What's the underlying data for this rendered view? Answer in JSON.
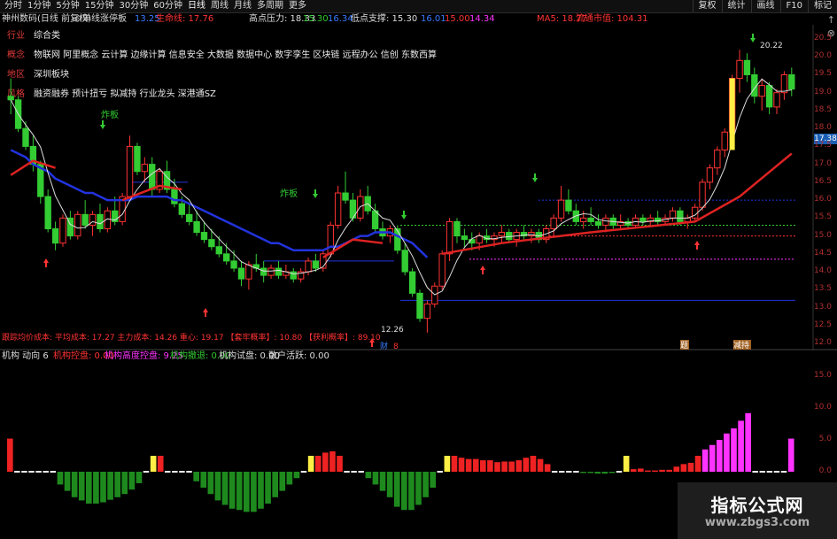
{
  "topbar": {
    "tabs": [
      "分时",
      "1分钟",
      "5分钟",
      "15分钟",
      "30分钟",
      "60分钟",
      "日线",
      "周线",
      "月线",
      "多周期",
      "更多"
    ],
    "active": "日线",
    "right": [
      "复权",
      "统计",
      "画线",
      "F10",
      "标记"
    ]
  },
  "info": {
    "stock": "神州数码(日线 前复权)",
    "indicator": "单线涨停板",
    "v1": "13.25",
    "lifeline_label": "生命线: 17.76",
    "high_label": "高点压力: 18.33",
    "high_v1": "15.30",
    "high_v2": "16.34",
    "low_label": "低点支撑: 15.30",
    "low_v0": "16.01",
    "low_v1": "15.00",
    "low_v2": "14.34",
    "ma5": "MA5: 18.77",
    "mktcap": "流通市值: 104.31"
  },
  "categories": [
    {
      "key": "行业",
      "value": "综合类"
    },
    {
      "key": "概念",
      "value": "物联网 阿里概念 云计算 边缘计算 信息安全 大数据 数据中心 数字孪生 区块链 远程办公 信创 东数西算"
    },
    {
      "key": "地区",
      "value": "深圳板块"
    },
    {
      "key": "风格",
      "value": "融资融券 预计扭亏 拟减持 行业龙头 深港通SZ"
    }
  ],
  "yaxis": [
    "20.5",
    "20.0",
    "19.5",
    "19.0",
    "18.5",
    "18.0",
    "17.5",
    "17.0",
    "16.5",
    "16.0",
    "15.5",
    "15.0",
    "14.5",
    "14.0",
    "13.5",
    "13.0",
    "12.5",
    "12.0"
  ],
  "yaxis_bottom": [
    "15.0",
    "10.0",
    "5.0",
    "0.0"
  ],
  "price_tag": "17.38",
  "annot": {
    "high_price": "20.22",
    "low_price": "12.26",
    "zhaban1": "炸板",
    "zhaban2": "炸板",
    "cost_line": "跟踪均价成本: 平均成本: 17.27  主力成本: 14.26  重心: 19.17  【套牢概率】: 10.80  【获利概率】: 89.10",
    "tag_cai": "财",
    "tag_8": "8",
    "tag_ju": "题",
    "tag_jian": "减持"
  },
  "bottom_info": {
    "title": "机构 动向 6",
    "k1": "机构控盘: 0.00",
    "k2": "机构高度控盘: 9.25",
    "k3": "机构撤退: 0.00",
    "k4": "机构试盘: 0.00",
    "k5": "散户活跃: 0.00"
  },
  "watermark": {
    "title": "指标公式网",
    "url": "www.zbgs3.com"
  },
  "colors": {
    "up": "#ff3333",
    "down": "#33cc33",
    "ma_blue": "#2233dd",
    "life_red": "#dd2222",
    "magenta": "#ff33ff",
    "yellow": "#ffee44"
  },
  "chart_data": {
    "type": "candlestick",
    "ylim": [
      12.0,
      20.5
    ],
    "candles": [
      [
        18.9,
        19.4,
        18.4,
        18.8
      ],
      [
        18.8,
        18.9,
        17.9,
        18.0
      ],
      [
        18.0,
        18.2,
        17.4,
        17.5
      ],
      [
        17.5,
        17.8,
        16.8,
        17.0
      ],
      [
        17.0,
        17.1,
        15.9,
        16.1
      ],
      [
        16.1,
        16.3,
        15.1,
        15.2
      ],
      [
        15.2,
        15.4,
        14.6,
        14.8
      ],
      [
        14.8,
        15.6,
        14.7,
        15.5
      ],
      [
        15.5,
        15.7,
        14.9,
        15.0
      ],
      [
        15.0,
        15.7,
        14.9,
        15.6
      ],
      [
        15.6,
        16.0,
        15.2,
        15.3
      ],
      [
        15.3,
        15.7,
        15.0,
        15.6
      ],
      [
        15.6,
        15.9,
        15.1,
        15.2
      ],
      [
        15.2,
        15.8,
        15.1,
        15.7
      ],
      [
        15.7,
        16.1,
        15.3,
        15.4
      ],
      [
        15.4,
        16.2,
        15.3,
        16.1
      ],
      [
        16.1,
        17.8,
        16.0,
        17.5
      ],
      [
        17.5,
        17.6,
        16.7,
        16.8
      ],
      [
        16.8,
        17.2,
        16.5,
        17.0
      ],
      [
        17.0,
        17.2,
        16.1,
        16.3
      ],
      [
        16.3,
        16.9,
        16.2,
        16.8
      ],
      [
        16.8,
        17.1,
        16.2,
        16.3
      ],
      [
        16.3,
        16.6,
        15.8,
        15.9
      ],
      [
        15.9,
        16.1,
        15.5,
        15.6
      ],
      [
        15.6,
        15.9,
        15.3,
        15.4
      ],
      [
        15.4,
        15.7,
        15.0,
        15.1
      ],
      [
        15.1,
        15.4,
        14.8,
        14.9
      ],
      [
        14.9,
        15.2,
        14.6,
        14.7
      ],
      [
        14.7,
        15.0,
        14.4,
        14.5
      ],
      [
        14.5,
        14.8,
        14.2,
        14.3
      ],
      [
        14.3,
        14.6,
        14.0,
        14.1
      ],
      [
        14.1,
        14.3,
        13.6,
        13.8
      ],
      [
        13.8,
        14.3,
        13.5,
        14.2
      ],
      [
        14.2,
        14.5,
        14.0,
        14.1
      ],
      [
        14.1,
        14.3,
        13.7,
        13.9
      ],
      [
        13.9,
        14.2,
        13.8,
        14.1
      ],
      [
        14.1,
        14.3,
        13.8,
        13.9
      ],
      [
        13.9,
        14.2,
        13.8,
        14.0
      ],
      [
        14.0,
        14.1,
        13.7,
        13.8
      ],
      [
        13.8,
        14.1,
        13.7,
        14.0
      ],
      [
        14.0,
        14.4,
        13.9,
        14.3
      ],
      [
        14.3,
        14.5,
        14.0,
        14.1
      ],
      [
        14.1,
        14.6,
        14.0,
        14.5
      ],
      [
        14.5,
        15.4,
        14.4,
        15.3
      ],
      [
        15.3,
        16.4,
        15.2,
        16.2
      ],
      [
        16.2,
        16.8,
        15.9,
        16.0
      ],
      [
        16.0,
        16.2,
        15.4,
        15.5
      ],
      [
        15.5,
        16.3,
        15.4,
        16.1
      ],
      [
        16.1,
        16.4,
        15.6,
        15.7
      ],
      [
        15.7,
        15.9,
        15.1,
        15.2
      ],
      [
        15.2,
        15.4,
        14.9,
        15.0
      ],
      [
        15.0,
        15.3,
        14.8,
        15.2
      ],
      [
        15.2,
        15.3,
        14.5,
        14.6
      ],
      [
        14.6,
        14.8,
        13.9,
        14.0
      ],
      [
        14.0,
        14.1,
        13.3,
        13.4
      ],
      [
        13.4,
        13.5,
        12.6,
        12.7
      ],
      [
        12.7,
        13.2,
        12.3,
        13.1
      ],
      [
        13.1,
        13.7,
        13.0,
        13.6
      ],
      [
        13.6,
        14.6,
        13.5,
        14.5
      ],
      [
        14.5,
        15.5,
        14.3,
        15.4
      ],
      [
        15.4,
        15.5,
        14.8,
        15.0
      ],
      [
        15.0,
        15.2,
        14.7,
        14.9
      ],
      [
        14.9,
        15.1,
        14.6,
        14.8
      ],
      [
        14.8,
        15.1,
        14.6,
        15.0
      ],
      [
        15.0,
        15.2,
        14.8,
        14.9
      ],
      [
        14.9,
        15.1,
        14.7,
        15.0
      ],
      [
        15.0,
        15.3,
        14.8,
        15.1
      ],
      [
        15.1,
        15.2,
        14.8,
        14.9
      ],
      [
        14.9,
        15.2,
        14.7,
        15.1
      ],
      [
        15.1,
        15.3,
        14.9,
        15.0
      ],
      [
        15.0,
        15.2,
        14.8,
        15.1
      ],
      [
        15.1,
        15.2,
        14.8,
        14.9
      ],
      [
        14.9,
        15.3,
        14.8,
        15.2
      ],
      [
        15.2,
        15.6,
        15.0,
        15.5
      ],
      [
        15.5,
        16.4,
        15.4,
        16.0
      ],
      [
        16.0,
        16.3,
        15.6,
        15.7
      ],
      [
        15.7,
        15.9,
        15.3,
        15.4
      ],
      [
        15.4,
        15.7,
        15.2,
        15.5
      ],
      [
        15.5,
        15.8,
        15.3,
        15.4
      ],
      [
        15.4,
        15.6,
        15.2,
        15.3
      ],
      [
        15.3,
        15.6,
        15.1,
        15.5
      ],
      [
        15.5,
        15.6,
        15.2,
        15.3
      ],
      [
        15.3,
        15.6,
        15.2,
        15.4
      ],
      [
        15.4,
        15.5,
        15.2,
        15.3
      ],
      [
        15.3,
        15.6,
        15.2,
        15.5
      ],
      [
        15.5,
        15.6,
        15.3,
        15.4
      ],
      [
        15.4,
        15.6,
        15.3,
        15.5
      ],
      [
        15.5,
        15.7,
        15.3,
        15.4
      ],
      [
        15.4,
        15.6,
        15.3,
        15.5
      ],
      [
        15.5,
        15.8,
        15.4,
        15.7
      ],
      [
        15.7,
        15.8,
        15.3,
        15.4
      ],
      [
        15.4,
        15.6,
        15.2,
        15.5
      ],
      [
        15.5,
        15.9,
        15.4,
        15.8
      ],
      [
        15.8,
        16.6,
        15.7,
        16.5
      ],
      [
        16.5,
        17.0,
        16.3,
        16.9
      ],
      [
        16.9,
        17.5,
        16.7,
        17.4
      ],
      [
        17.4,
        18.0,
        17.2,
        17.9
      ],
      [
        17.9,
        19.5,
        17.8,
        19.4
      ],
      [
        19.4,
        20.2,
        19.0,
        19.9
      ],
      [
        19.9,
        20.1,
        19.3,
        19.5
      ],
      [
        19.5,
        19.7,
        18.7,
        18.9
      ],
      [
        18.9,
        19.4,
        18.5,
        19.2
      ],
      [
        19.2,
        19.3,
        18.4,
        18.6
      ],
      [
        18.6,
        19.1,
        18.4,
        19.0
      ],
      [
        19.0,
        19.6,
        18.8,
        19.5
      ],
      [
        19.5,
        19.7,
        18.9,
        19.1
      ]
    ],
    "ma_blue": [
      17.4,
      17.3,
      17.2,
      17.0,
      16.9,
      16.8,
      16.6,
      16.5,
      16.4,
      16.3,
      16.2,
      16.2,
      16.1,
      16.0,
      16.0,
      16.0,
      16.0,
      16.1,
      16.1,
      16.1,
      16.1,
      16.1,
      16.0,
      16.0,
      15.9,
      15.8,
      15.7,
      15.6,
      15.5,
      15.4,
      15.3,
      15.2,
      15.1,
      15.0,
      14.9,
      14.8,
      14.8,
      14.7,
      14.6,
      14.6,
      14.6,
      14.6,
      14.6,
      14.7,
      14.7,
      14.8,
      14.9,
      15.0,
      15.0,
      15.1,
      15.1,
      15.1,
      15.0,
      14.9,
      14.8,
      14.6,
      14.4
    ],
    "life_red_start": 56,
    "mech_bars": [
      5.2,
      0,
      0,
      0,
      0,
      0,
      0,
      -2,
      -3,
      -4,
      -4.5,
      -5,
      -5,
      -4.8,
      -4.4,
      -4,
      -3.5,
      -2.8,
      -1.8,
      0,
      2.5,
      2.5,
      0,
      0,
      0,
      0,
      -1.5,
      -2.5,
      -3.5,
      -4.5,
      -5.2,
      -5.8,
      -6,
      -6.3,
      -6.3,
      -5.8,
      -5,
      -4,
      -3,
      -2,
      -1,
      0,
      2.5,
      2.5,
      3,
      3.2,
      2.5,
      0,
      0,
      0,
      -1,
      -2,
      -3,
      -4,
      -5.5,
      -6,
      -6,
      -5.2,
      -4,
      -2.5,
      0,
      2.5,
      2.5,
      2.2,
      2,
      2,
      1.8,
      1.8,
      1.5,
      1.6,
      1.6,
      1.8,
      2.2,
      2.5,
      2,
      1.2,
      0,
      0,
      0,
      0,
      -0.2,
      -0.2,
      -0.3,
      -0.3,
      -0.2,
      0,
      2.5,
      0.4,
      0.5,
      0.2,
      0.2,
      0.3,
      0.3,
      0.8,
      1.2,
      1.4,
      2.5,
      3.5,
      4.2,
      5,
      6,
      6.8,
      8,
      9.2,
      0,
      0,
      0,
      0,
      0,
      5.2
    ]
  }
}
